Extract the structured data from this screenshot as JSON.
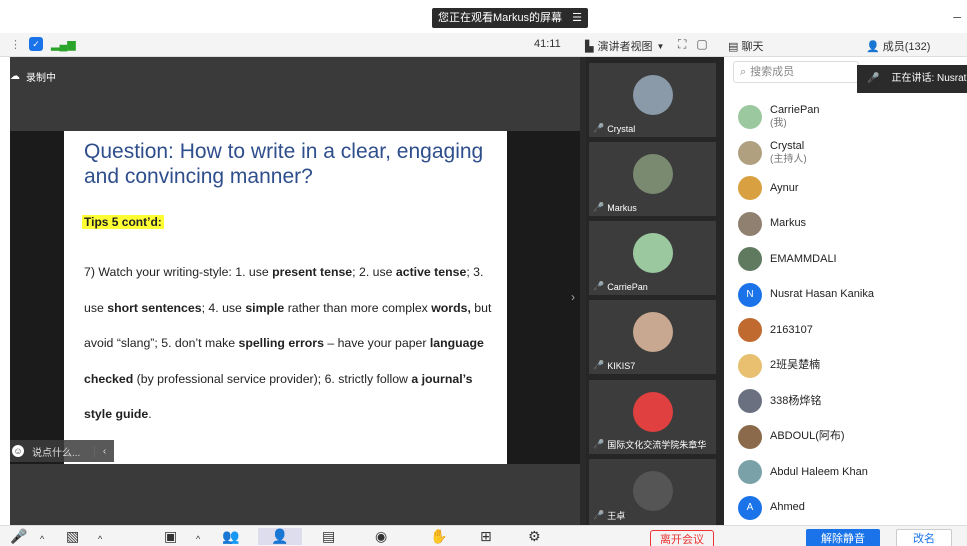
{
  "banner": {
    "text": "您正在观看Markus的屏幕",
    "menu_icon": "menu-icon"
  },
  "toolbar": {
    "timer": "41:11",
    "presenter_view": "演讲者视图",
    "chat_tab": "聊天",
    "members_tab": "成员(132)"
  },
  "stage": {
    "recording": "录制中",
    "say_placeholder": "说点什么..."
  },
  "slide": {
    "title": "Question: How to write in a clear, engaging and convincing manner?",
    "tips": "Tips 5 cont’d:",
    "body_segments": [
      {
        "t": "7)   Watch your writing-style: 1. use ",
        "b": false
      },
      {
        "t": "present  tense",
        "b": true
      },
      {
        "t": "; 2. use ",
        "b": false
      },
      {
        "t": "active tense",
        "b": true
      },
      {
        "t": "; 3. use ",
        "b": false
      },
      {
        "t": "short sentences",
        "b": true
      },
      {
        "t": "; 4. use ",
        "b": false
      },
      {
        "t": "simple",
        "b": true
      },
      {
        "t": " rather than more complex ",
        "b": false
      },
      {
        "t": "words,",
        "b": true
      },
      {
        "t": " but avoid “slang”; 5. don’t make ",
        "b": false
      },
      {
        "t": "spelling errors",
        "b": true
      },
      {
        "t": " – have your paper ",
        "b": false
      },
      {
        "t": "language checked",
        "b": true
      },
      {
        "t": " (by professional service provider); 6. strictly follow ",
        "b": false
      },
      {
        "t": "a journal’s style guide",
        "b": true
      },
      {
        "t": ".",
        "b": false
      }
    ]
  },
  "videos": [
    {
      "name": "Crystal",
      "color": "#8a9aa8"
    },
    {
      "name": "Markus",
      "color": "#7a8a70"
    },
    {
      "name": "CarriePan",
      "color": "#9cc8a0"
    },
    {
      "name": "KIKIS7",
      "color": "#c8a890"
    },
    {
      "name": "国际文化交流学院朱章华",
      "color": "#e04040"
    },
    {
      "name": "王卓",
      "color": "#555555"
    }
  ],
  "members": {
    "search_placeholder": "搜索成员",
    "speaking": "正在讲话: Nusrat",
    "list": [
      {
        "name": "CarriePan",
        "sub": "(我)",
        "color": "#9cc8a0"
      },
      {
        "name": "Crystal",
        "sub": "(主持人)",
        "color": "#b0a080"
      },
      {
        "name": "Aynur",
        "sub": "",
        "color": "#d8a040"
      },
      {
        "name": "Markus",
        "sub": "",
        "color": "#908070"
      },
      {
        "name": "EMAMMDALI",
        "sub": "",
        "color": "#607a60"
      },
      {
        "name": "Nusrat Hasan Kanika",
        "sub": "",
        "color": "#1a73e8",
        "initial": "N"
      },
      {
        "name": "2163107",
        "sub": "",
        "color": "#c06a30"
      },
      {
        "name": "2班吴楚楠",
        "sub": "",
        "color": "#e8c070"
      },
      {
        "name": "338杨烨铭",
        "sub": "",
        "color": "#6a7080"
      },
      {
        "name": "ABDOUL(阿布)",
        "sub": "",
        "color": "#8a6a4a"
      },
      {
        "name": "Abdul Haleem Khan",
        "sub": "",
        "color": "#7aa0a8"
      },
      {
        "name": "Ahmed",
        "sub": "",
        "color": "#1a73e8",
        "initial": "A"
      }
    ]
  },
  "bottom": {
    "leave": "离开会议",
    "unmute_all": "解除静音",
    "rename": "改名"
  }
}
